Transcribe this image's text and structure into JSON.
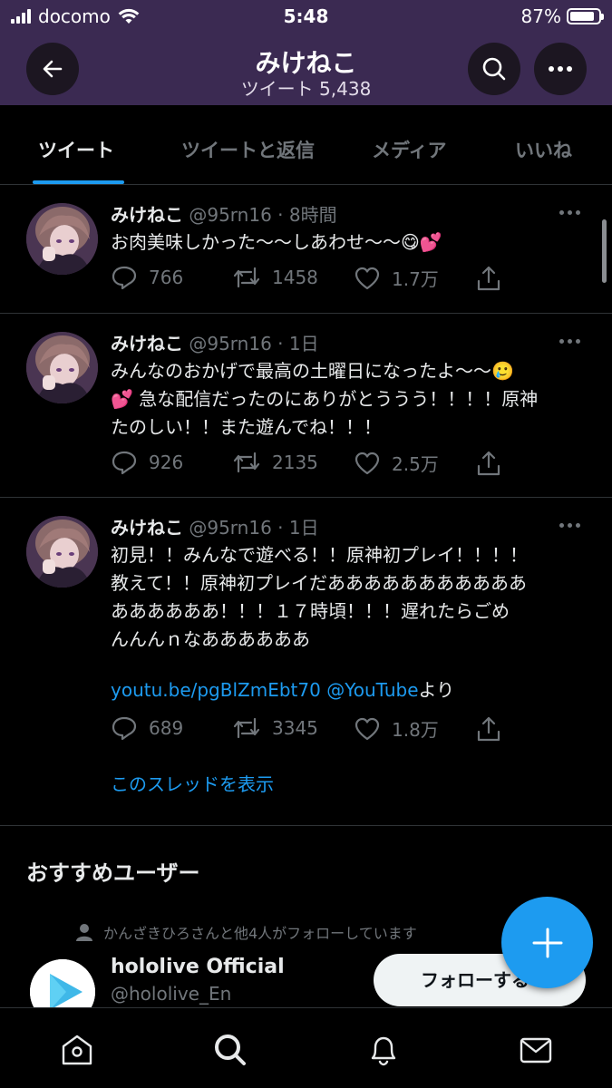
{
  "status_bar": {
    "carrier": "docomo",
    "time": "5:48",
    "battery_percent": "87%",
    "battery_level": 0.87
  },
  "header": {
    "title": "みけねこ",
    "subtitle": "ツイート 5,438"
  },
  "tabs": [
    {
      "label": "ツイート",
      "active": true
    },
    {
      "label": "ツイートと返信",
      "active": false
    },
    {
      "label": "メディア",
      "active": false
    },
    {
      "label": "いいね",
      "active": false
    }
  ],
  "tweets": [
    {
      "name": "みけねこ",
      "meta": "@95rn16 · 8時間",
      "text": "お肉美味しかった〜〜しあわせ〜〜😋💕",
      "replies": "766",
      "retweets": "1458",
      "likes": "1.7万"
    },
    {
      "name": "みけねこ",
      "meta": "@95rn16 · 1日",
      "text": "みんなのおかげで最高の土曜日になったよ〜〜🥲\n💕 急な配信だったのにありがとううう！！！！原神\nたのしい！！また遊んでね！！！",
      "replies": "926",
      "retweets": "2135",
      "likes": "2.5万"
    },
    {
      "name": "みけねこ",
      "meta": "@95rn16 · 1日",
      "text": "初見！！みんなで遊べる！！原神初プレイ！！！！\n教えて！！原神初プレイだあああああああああああ\nああああああ！！！１７時頃！！！遅れたらごめ\nんんんｎなああああああ",
      "link": "youtu.be/pgBlZmEbt70",
      "mention": "@YouTube",
      "link_suffix": "より",
      "replies": "689",
      "retweets": "3345",
      "likes": "1.8万",
      "thread_link": "このスレッドを表示"
    }
  ],
  "recommended": {
    "title": "おすすめユーザー",
    "social_context": "かんざきひろさんと他4人がフォローしています",
    "name": "hololive Official",
    "handle": "@hololive_En",
    "follow_label": "フォローする"
  },
  "bottom_nav": [
    "home-icon",
    "search-icon",
    "notifications-icon",
    "messages-icon"
  ],
  "colors": {
    "header_bg": "#3b2a52",
    "accent": "#1d9bf0",
    "muted": "#71767b"
  }
}
